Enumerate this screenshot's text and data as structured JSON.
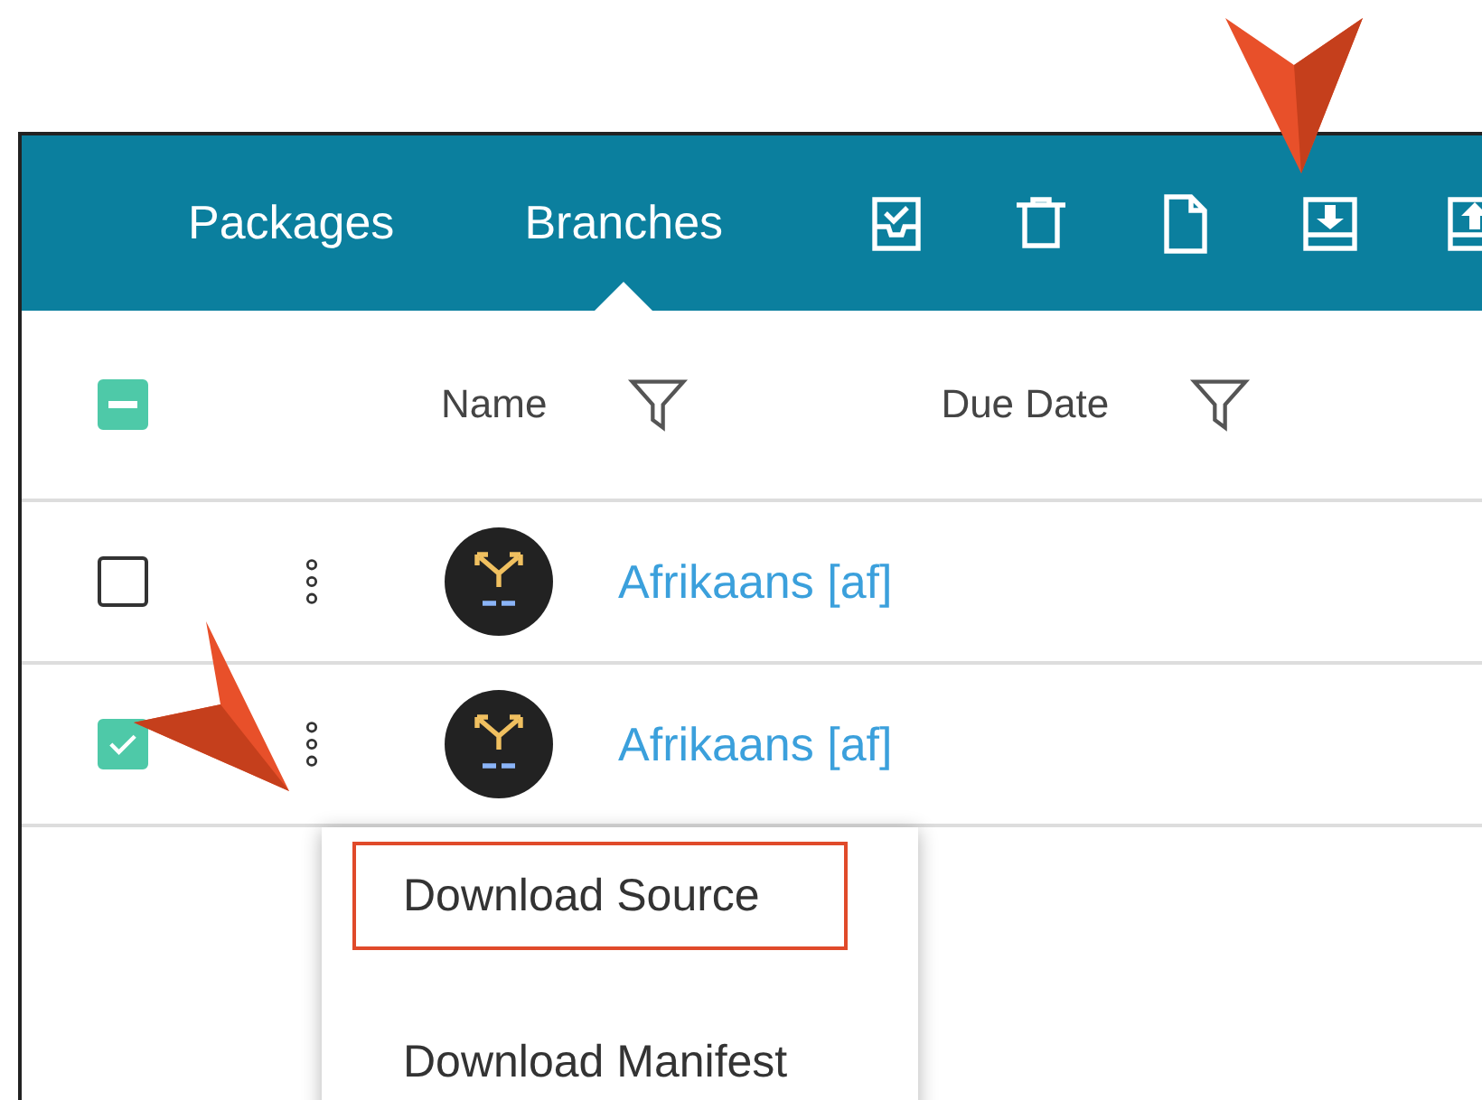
{
  "tabs": [
    {
      "label": "Packages",
      "selected": false
    },
    {
      "label": "Branches",
      "selected": true
    }
  ],
  "toolbar": [
    {
      "kind": "checklist"
    },
    {
      "kind": "delete"
    },
    {
      "kind": "file"
    },
    {
      "kind": "download"
    },
    {
      "kind": "upload"
    }
  ],
  "table": {
    "select_all": {
      "indeterminate": true
    },
    "columns": [
      "Name",
      "Due Date"
    ],
    "rows": [
      {
        "checked": false,
        "name": "Afrikaans [af]"
      },
      {
        "checked": true,
        "name": "Afrikaans [af]"
      }
    ]
  },
  "context_menu": {
    "items": [
      {
        "label": "Download Source",
        "highlighted": true
      },
      {
        "label": "Download Manifest",
        "highlighted": false
      }
    ]
  }
}
